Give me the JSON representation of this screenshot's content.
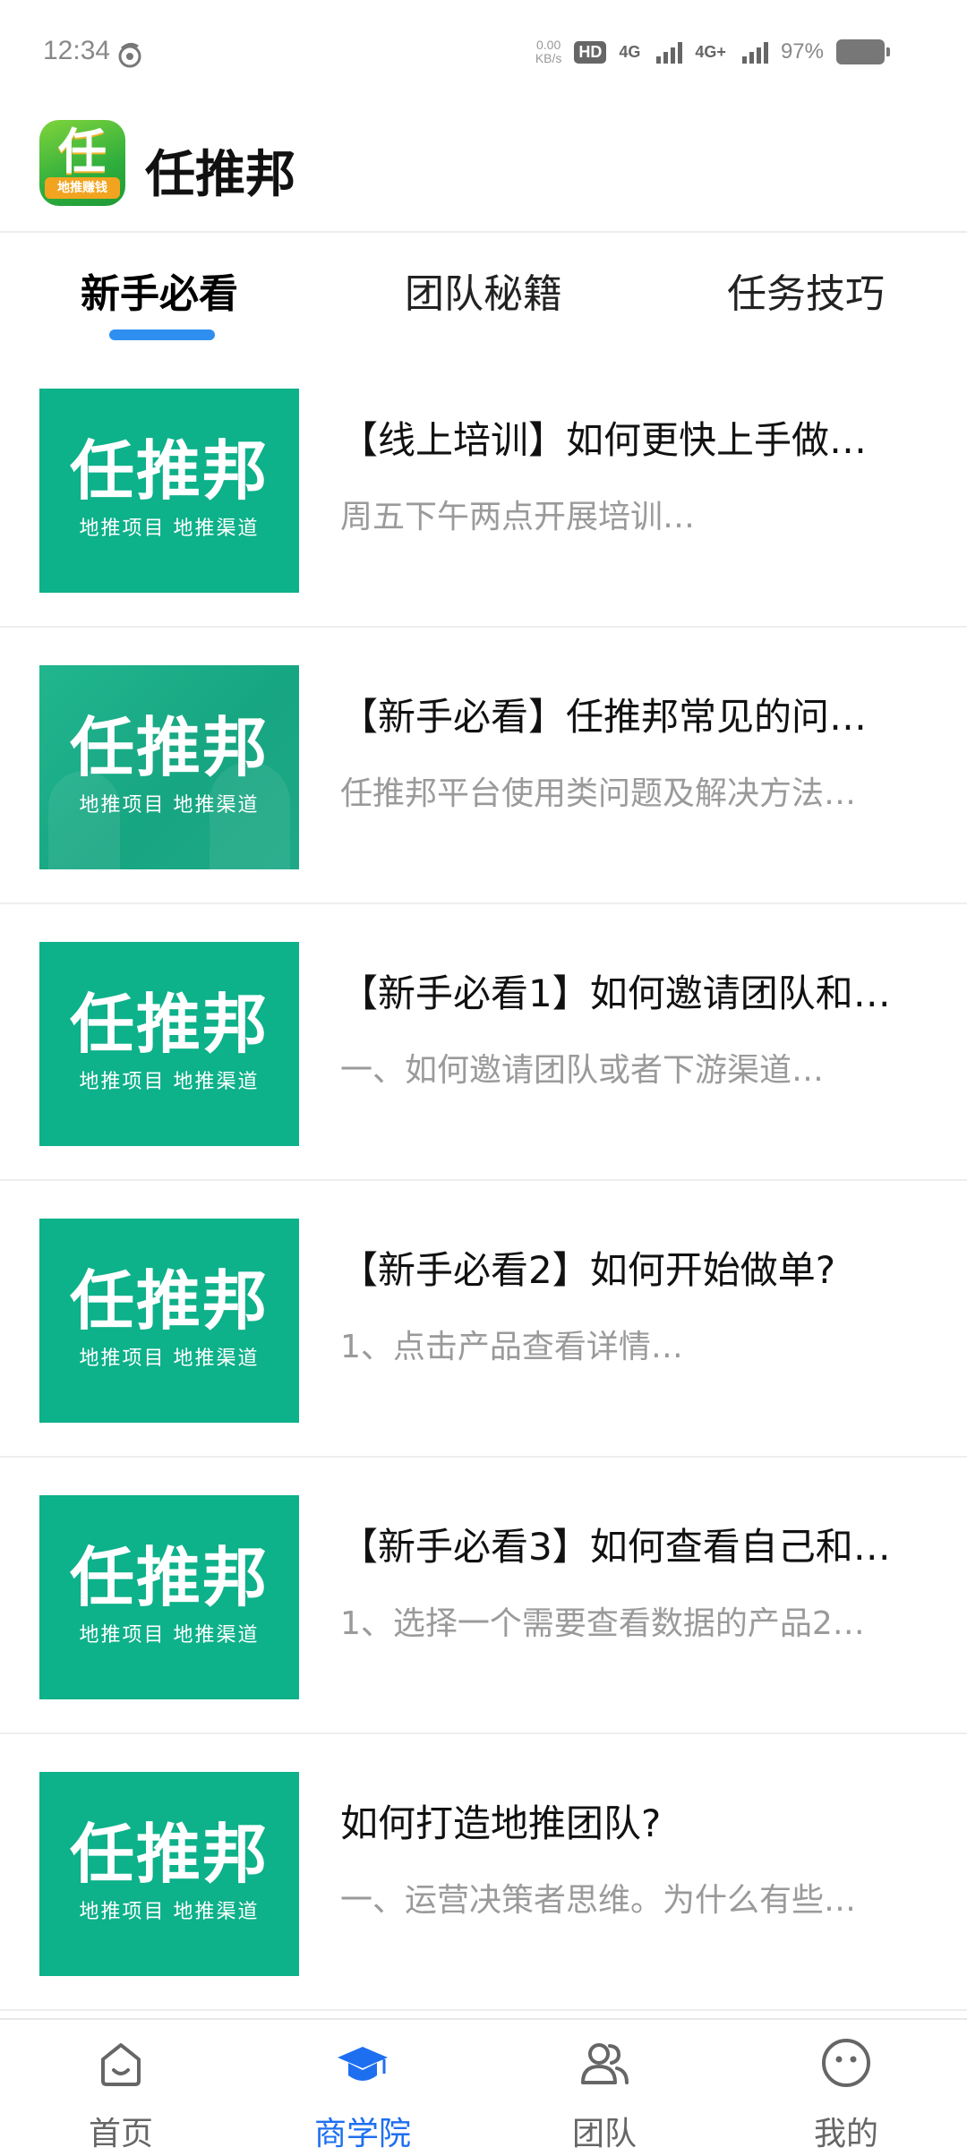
{
  "status_bar": {
    "time": "12:34",
    "net_speed_value": "0.00",
    "net_speed_unit": "KB/s",
    "hd_label": "HD",
    "sim1_label": "4G",
    "sim2_label": "4G+",
    "battery": "97%"
  },
  "header": {
    "logo_char": "任",
    "logo_strip": "地推赚钱",
    "title": "任推邦"
  },
  "tabs": [
    {
      "label": "新手必看",
      "active": true
    },
    {
      "label": "团队秘籍",
      "active": false
    },
    {
      "label": "任务技巧",
      "active": false
    }
  ],
  "thumb_brand": "任推邦",
  "thumb_sub": "地推项目 地推渠道",
  "articles": [
    {
      "title": "【线上培训】如何更快上手做…",
      "desc": "周五下午两点开展培训…"
    },
    {
      "title": "【新手必看】任推邦常见的问…",
      "desc": "任推邦平台使用类问题及解决方法…"
    },
    {
      "title": "【新手必看1】如何邀请团队和…",
      "desc": "一、如何邀请团队或者下游渠道…"
    },
    {
      "title": "【新手必看2】如何开始做单?",
      "desc": "1、点击产品查看详情…"
    },
    {
      "title": "【新手必看3】如何查看自己和…",
      "desc": "1、选择一个需要查看数据的产品2…"
    },
    {
      "title": "如何打造地推团队?",
      "desc": "一、运营决策者思维。为什么有些…"
    }
  ],
  "bottom_nav": [
    {
      "label": "首页",
      "icon": "home-icon",
      "active": false
    },
    {
      "label": "商学院",
      "icon": "graduation-cap-icon",
      "active": true
    },
    {
      "label": "团队",
      "icon": "team-icon",
      "active": false
    },
    {
      "label": "我的",
      "icon": "profile-face-icon",
      "active": false
    }
  ],
  "colors": {
    "accent": "#1e6ff0",
    "tab_indicator": "#2f8ff0",
    "thumb_green": "#0db18a",
    "muted_text": "#9a9a9a"
  }
}
